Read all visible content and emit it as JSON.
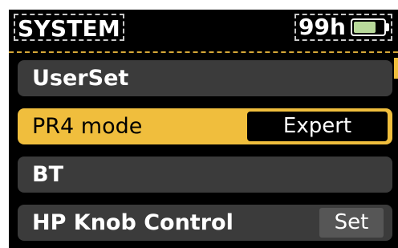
{
  "header": {
    "title": "SYSTEM",
    "hours": "99h",
    "battery_level": 0.75
  },
  "colors": {
    "accent": "#f0be3d",
    "row_background": "#3b3b3b",
    "battery_fill": "#b8d99a"
  },
  "menu": {
    "items": [
      {
        "label": "UserSet",
        "value": ""
      },
      {
        "label": "PR4 mode",
        "value": "Expert"
      },
      {
        "label": "BT",
        "value": ""
      },
      {
        "label": "HP Knob Control",
        "value": "Set"
      }
    ]
  }
}
